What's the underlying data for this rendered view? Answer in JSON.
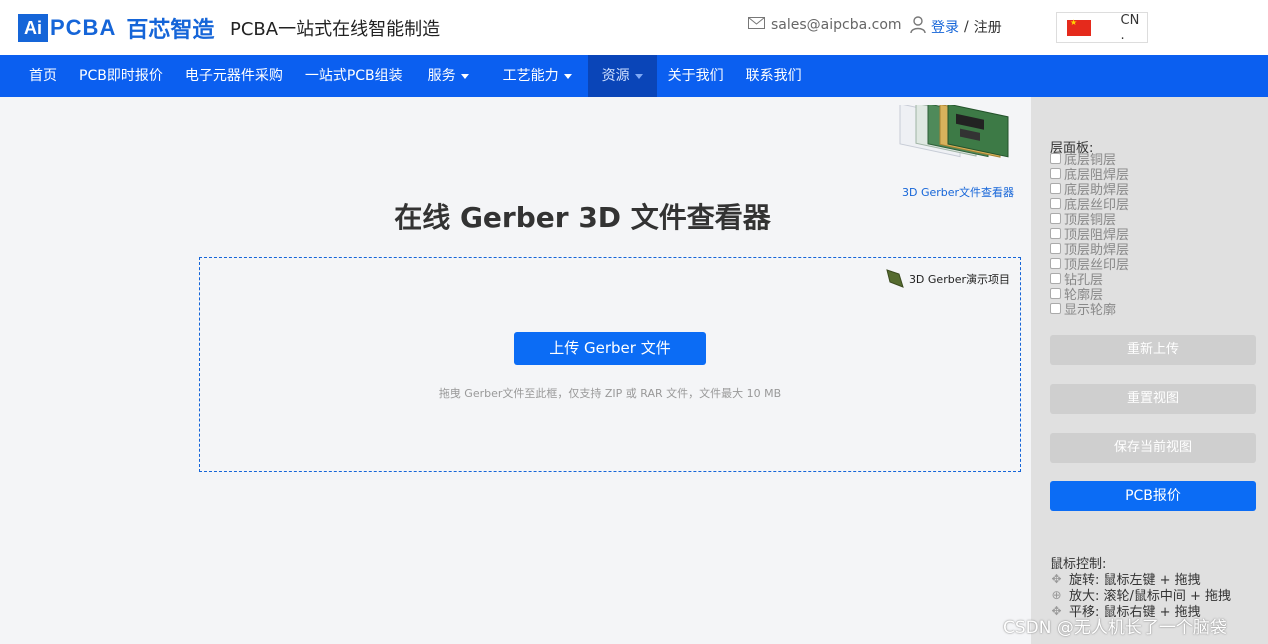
{
  "header": {
    "logo_ai": "Ai",
    "logo_pcba": "PCBA",
    "logo_cn": "百芯智造",
    "slogan": "PCBA一站式在线智能制造",
    "email": "sales@aipcba.com",
    "login": "登录",
    "separator": " / ",
    "register": "注册",
    "lang": "CN ."
  },
  "nav": {
    "items": [
      {
        "label": "首页"
      },
      {
        "label": "PCB即时报价"
      },
      {
        "label": "电子元器件采购"
      },
      {
        "label": "一站式PCB组装"
      },
      {
        "label": "服务"
      },
      {
        "label": "工艺能力"
      },
      {
        "label": "资源"
      },
      {
        "label": "关于我们"
      },
      {
        "label": "联系我们"
      }
    ]
  },
  "main": {
    "thumb_label": "3D Gerber文件查看器",
    "title": "在线 Gerber 3D 文件查看器",
    "demo_label": "3D Gerber演示项目",
    "upload_button": "上传 Gerber 文件",
    "hint": "拖曳 Gerber文件至此框，仅支持 ZIP 或 RAR 文件，文件最大 10 MB"
  },
  "side": {
    "layers_title": "层面板:",
    "layers": [
      "底层铜层",
      "底层阻焊层",
      "底层助焊层",
      "底层丝印层",
      "顶层铜层",
      "顶层阻焊层",
      "顶层助焊层",
      "顶层丝印层",
      "钻孔层",
      "轮廓层",
      "显示轮廓"
    ],
    "buttons": {
      "reupload": "重新上传",
      "reset_view": "重置视图",
      "save_view": "保存当前视图",
      "pcb_quote": "PCB报价"
    },
    "mouse_title": "鼠标控制:",
    "mouse_rotate": "旋转: 鼠标左键 + 拖拽",
    "mouse_zoom": "放大: 滚轮/鼠标中间 + 拖拽",
    "mouse_pan": "平移: 鼠标右键 + 拖拽"
  },
  "watermark": "CSDN @无人机长了一个脑袋"
}
